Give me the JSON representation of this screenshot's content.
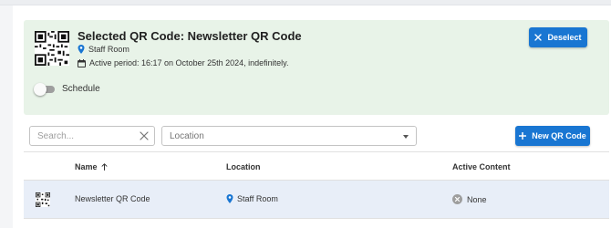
{
  "selected": {
    "title": "Selected QR Code: Newsletter QR Code",
    "location": "Staff Room",
    "active_period": "Active period: 16:17 on October 25th 2024, indefinitely.",
    "deselect_label": "Deselect",
    "schedule_label": "Schedule",
    "schedule_enabled": false
  },
  "filters": {
    "search_placeholder": "Search...",
    "location_placeholder": "Location"
  },
  "new_qr_label": "New QR Code",
  "table": {
    "columns": {
      "name": "Name",
      "location": "Location",
      "active_content": "Active Content"
    },
    "sort": {
      "column": "name",
      "direction": "asc"
    },
    "rows": [
      {
        "name": "Newsletter QR Code",
        "location": "Staff Room",
        "active_content": "None"
      }
    ]
  },
  "colors": {
    "primary": "#1976d2",
    "selected_bg": "#e8f3e8",
    "row_highlight": "#e8eef8"
  }
}
